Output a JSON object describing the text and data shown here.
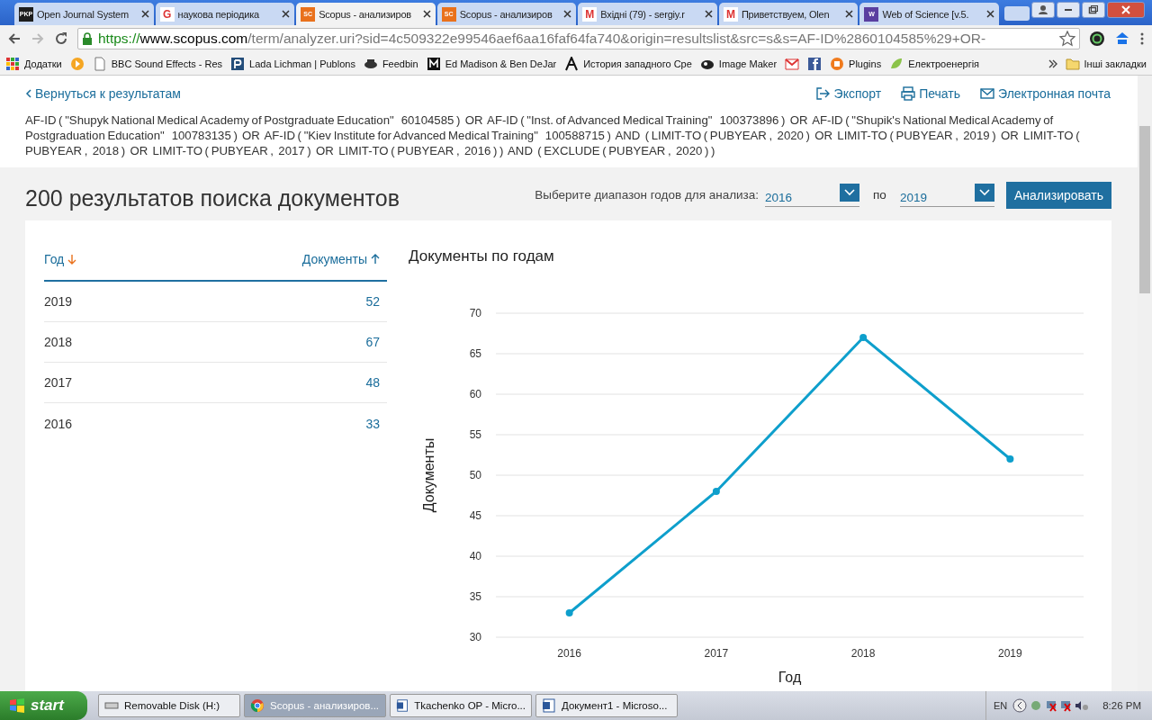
{
  "browser": {
    "tabs": [
      {
        "favicon": "PKP",
        "title": "Open Journal System",
        "selected": false
      },
      {
        "favicon": "G",
        "title": "наукова періодика",
        "selected": false
      },
      {
        "favicon": "SC",
        "title": "Scopus - анализиров",
        "selected": true
      },
      {
        "favicon": "SC",
        "title": "Scopus - анализиров",
        "selected": false
      },
      {
        "favicon": "M",
        "title": "Вхідні (79) - sergiy.r",
        "selected": false
      },
      {
        "favicon": "M",
        "title": "Приветствуем, Olen",
        "selected": false
      },
      {
        "favicon": "W",
        "title": "Web of Science [v.5.",
        "selected": false
      }
    ],
    "url_scheme": "https://",
    "url_host": "www.scopus.com",
    "url_rest": "/term/analyzer.uri?sid=4c509322e99546aef6aa16faf64fa740&origin=resultslist&src=s&s=AF-ID%2860104585%29+OR-",
    "bookmarks": [
      {
        "kind": "link",
        "title": "Додатки"
      },
      {
        "kind": "icon"
      },
      {
        "kind": "link",
        "title": "BBC Sound Effects - Res"
      },
      {
        "kind": "link",
        "title": "Lada Lichman | Publons"
      },
      {
        "kind": "link",
        "title": "Feedbin"
      },
      {
        "kind": "link",
        "title": "Ed Madison & Ben DeJar"
      },
      {
        "kind": "link",
        "title": "История западного Сре"
      },
      {
        "kind": "link",
        "title": "Image Maker"
      },
      {
        "kind": "icon"
      },
      {
        "kind": "icon"
      },
      {
        "kind": "link",
        "title": "Plugins"
      },
      {
        "kind": "link",
        "title": "Електроенергія"
      }
    ],
    "other_bookmarks": "Інші закладки"
  },
  "page": {
    "back_link": "Вернуться к результатам",
    "actions": [
      "Экспорт",
      "Печать",
      "Электронная почта"
    ],
    "query": "AF-ID ( \"Shupyk National Medical Academy of Postgraduate Education\"   60104585 )  OR  AF-ID ( \"Inst. of Advanced Medical Training\"   100373896 )  OR  AF-ID ( \"Shupik's National Medical Academy of Postgraduation Education\"   100783135 )  OR  AF-ID ( \"Kiev Institute for Advanced Medical Training\"   100588715 )  AND  ( LIMIT-TO ( PUBYEAR ,  2020 )  OR  LIMIT-TO ( PUBYEAR ,  2019 )  OR  LIMIT-TO ( PUBYEAR ,  2018 )  OR  LIMIT-TO ( PUBYEAR ,  2017 )  OR  LIMIT-TO ( PUBYEAR ,  2016 ) )  AND  ( EXCLUDE ( PUBYEAR ,  2020 ) )",
    "results_title": "200 результатов поиска документов",
    "range_label": "Выберите диапазон годов для анализа:",
    "range_from": "2016",
    "range_sep": "по",
    "range_to": "2019",
    "analyze_button": "Анализировать",
    "table": {
      "columns": [
        "Год",
        "Документы"
      ],
      "rows": [
        [
          "2019",
          "52"
        ],
        [
          "2018",
          "67"
        ],
        [
          "2017",
          "48"
        ],
        [
          "2016",
          "33"
        ]
      ]
    },
    "chart_data": {
      "type": "line",
      "title": "Документы по годам",
      "xlabel": "Год",
      "ylabel": "Документы",
      "categories": [
        "2016",
        "2017",
        "2018",
        "2019"
      ],
      "series": [
        {
          "color": "#0e9fcc",
          "marker": true,
          "values": [
            33,
            48,
            67,
            52
          ]
        }
      ],
      "grid": true,
      "ylim": [
        30,
        70
      ],
      "yticks": [
        30,
        35,
        40,
        45,
        50,
        55,
        60,
        65,
        70
      ]
    }
  },
  "taskbar": {
    "start": "start",
    "items": [
      {
        "title": "Removable Disk (H:)",
        "selected": false
      },
      {
        "title": "Scopus - анализиров...",
        "selected": true
      },
      {
        "title": "Tkachenko OP - Micro...",
        "selected": false
      },
      {
        "title": "Документ1 - Microso...",
        "selected": false
      }
    ],
    "language": "EN",
    "time": "8:26 PM"
  }
}
